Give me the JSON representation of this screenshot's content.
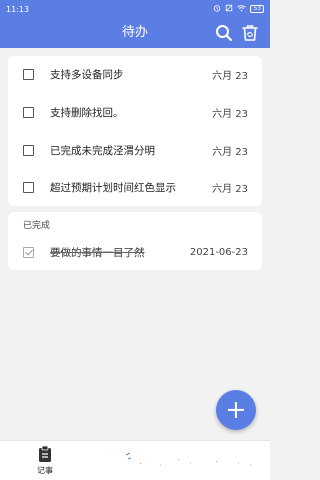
{
  "status_bar": {
    "time": "11:13",
    "battery": "53"
  },
  "app_bar": {
    "title": "待办"
  },
  "pending_items": [
    {
      "text": "支持多设备同步",
      "date": "六月 23"
    },
    {
      "text": "支持删除找回。",
      "date": "六月 23"
    },
    {
      "text": "已完成未完成泾渭分明",
      "date": "六月 23"
    },
    {
      "text": "超过预期计划时间红色显示",
      "date": "六月 23"
    }
  ],
  "completed_section": {
    "label": "已完成",
    "items": [
      {
        "text": "要做的事情一目了然",
        "date": "2021-06-23"
      }
    ]
  },
  "bottom_nav": {
    "notes_label": "记事"
  },
  "colors": {
    "primary": "#5b7ee5",
    "background": "#f2f2f2"
  }
}
